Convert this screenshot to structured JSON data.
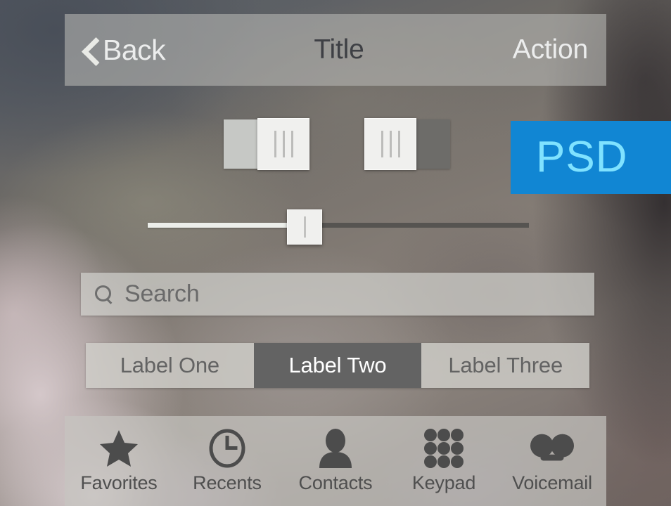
{
  "nav": {
    "back_label": "Back",
    "back_icon": "chevron-left-icon",
    "title": "Title",
    "action_label": "Action"
  },
  "controls": {
    "switch_on": {
      "name": "switch-on",
      "state": "on"
    },
    "switch_off": {
      "name": "switch-off",
      "state": "off"
    },
    "slider": {
      "name": "slider",
      "value_percent": 41
    }
  },
  "badge": {
    "label": "PSD",
    "background_color": "#1186d3",
    "text_color": "#7fe2ff"
  },
  "search": {
    "icon": "search-icon",
    "placeholder": "Search",
    "value": ""
  },
  "segmented": {
    "selected_index": 1,
    "selected_color": "#636363",
    "segments": [
      {
        "label": "Label One"
      },
      {
        "label": "Label Two"
      },
      {
        "label": "Label Three"
      }
    ]
  },
  "tab_bar": {
    "items": [
      {
        "label": "Favorites",
        "icon": "star-icon"
      },
      {
        "label": "Recents",
        "icon": "clock-icon"
      },
      {
        "label": "Contacts",
        "icon": "person-icon"
      },
      {
        "label": "Keypad",
        "icon": "keypad-dots-icon"
      },
      {
        "label": "Voicemail",
        "icon": "voicemail-icon"
      }
    ],
    "icon_color": "#4c4c4c"
  }
}
